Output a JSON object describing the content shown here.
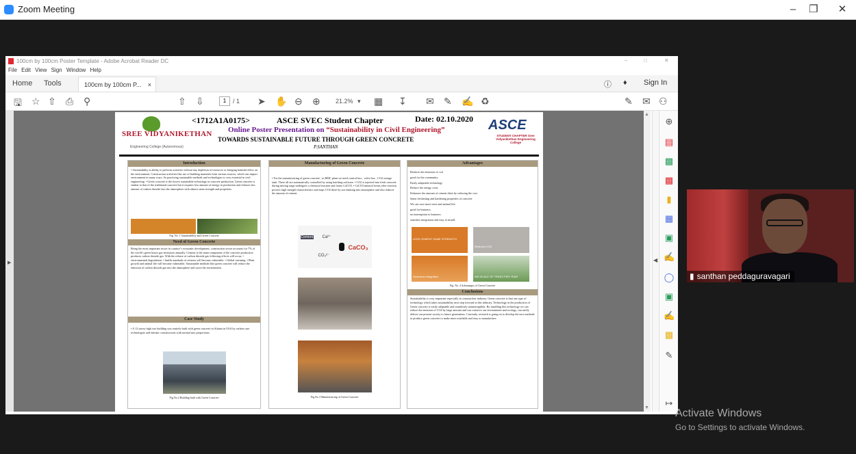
{
  "zoom": {
    "title": "Zoom Meeting"
  },
  "acrobat": {
    "window_title": "100cm by 100cm Poster Template - Adobe Acrobat Reader DC",
    "menu": [
      "File",
      "Edit",
      "View",
      "Sign",
      "Window",
      "Help"
    ],
    "tabs": {
      "home": "Home",
      "tools": "Tools",
      "doc": "100cm by 100cm P...",
      "close": "×",
      "sign_in": "Sign In"
    },
    "toolbar": {
      "page_current": "1",
      "page_total": "/ 1",
      "zoom": "21.2%"
    }
  },
  "poster": {
    "logo_name": "SREE VIDYANIKETHAN",
    "logo_sub": "Engineering College (Autonomous)",
    "id": "<1712A1A0175>",
    "chapter": "ASCE SVEC Student Chapter",
    "date": "Date: 02.10.2020",
    "online_prefix": "Online Poster Presentation on",
    "online_topic": "“Sustainability in Civil Engineering”",
    "title": "TOWARDS SUSTAINABLE FUTURE THROUGH  GREEN CONCRETE",
    "author": "P.SANTHAN",
    "asce": "ASCE",
    "asce_sub": "STUDENT CHAPTER Sree Vidyanikethan Engineering College",
    "sections": {
      "intro": {
        "title": "Introduction",
        "text": "• Sustainability is ability to perform activities without any depletion of resources or bringing harmful effect on the environment. Construction activities like use of building materials from various sources, which can impact environment in many ways. So practicing sustainable methods and technologies is very essential in civil engineering. • Green concrete is the lowest sustainable technology in concrete production. Green concrete is similar to that of the traditional concrete but it requires  less amount of energy  in production and releases less amount of carbon dioxide into the atmosphere with almost same strength and properties.",
        "caption": "Fig. No. 1 Sustainability  and Green Concrete"
      },
      "need": {
        "title": "Need of Green Concrete",
        "text": "Being the most important sector in country’s economic development, construction sector accounts for 7% of the world’s green house gas emissions annually.  Cement is the main component of the concrete production  produces carbon dioxide gas.  With the release  of carbon dioxide gas following effects will occur, •  environmental degradation. •  health standards of citizens will become vulnerable. •  Global warming. •  Plant growth and animal life will become vulnerable. Sustainable methods like green concrete will reduce the emission of carbon dioxide gas into the atmosphere and saves  the environment."
      },
      "case": {
        "title": "Case Study",
        "text": "•  A 12 storey high rise building was entirely  built with green concrete  in Atlanta  in USA by carbon cure technologies and  thermic constructions with normal mix proportions.",
        "caption": "Fig.No.2 Building built with Green Concrete"
      },
      "manuf": {
        "title": "Manufacturing of Green Concrete",
        "text": "• For the manufacturing of  green concrete , in RMC plant we need  control box ,   valve box ,  CO2 storage tank.   These  all  are  automatically controlled by using batching software. • CO2 is injected into fresh concrete during mixing stage undergoes   a chemical reaction and forms CaCO3. • CaCO3 mineral forms after reaction possess high strength characteristics  and traps CO2 there by not  emitting  into atmosphere and also reduces the amount of cement.",
        "diagram_labels": [
          "Cement",
          "Ca²⁺",
          "CO₃²⁻",
          "CaCO₃"
        ],
        "caption": "Fig.No.3 Manufacturing of  Green Concrete"
      },
      "adv": {
        "title": "Advantages",
        "items": [
          "Reduces the emission of co2",
          "good  for the community",
          "Easily adaptable technology",
          "Reduce the energy costs",
          "Enhances the amount of  cement  there by reducing the cost",
          "Same freshening and hardening properties of concrete",
          "We can save more trees and animal life.",
          "good for business.",
          "no interruption to business.",
          "seamless integration and easy to install."
        ],
        "tiles": [
          "LESS CEMENT   SAME STRENGTH",
          "Reduces CO2",
          "Seamless integration",
          "450 SCALE OF TREES PER YEAR"
        ],
        "caption": "Fig. No. 4 Advantages of Green Concrete"
      },
      "concl": {
        "title": "Conclusions",
        "text": "Sustainability is very important especially in construction industry. Green concrete is that one type of technology which  takes sustainability next step forward in this industry. Technology in the production of Green concrete is easily adaptable and seamlessly uninterruptible. By installing this technology we can  reduce the emission of CO2 by large amount and can conserve our environment and ecology, can  safely deliver our present society to future generations. Currently, research is going on to develop the new methods  to produce green concrete to make more available and easy to manufacture."
      }
    }
  },
  "participant": {
    "name": "santhan peddaguravagari"
  },
  "watermark": {
    "title": "Activate Windows",
    "subtitle": "Go to Settings to activate Windows."
  },
  "colors": {
    "zoom_blue": "#2d8cff",
    "adobe_red": "#e0282f",
    "section_header": "#a89a7e",
    "poster_purple": "#6a1b8f",
    "poster_red": "#b0182e",
    "asce_blue": "#1e3d7a"
  }
}
